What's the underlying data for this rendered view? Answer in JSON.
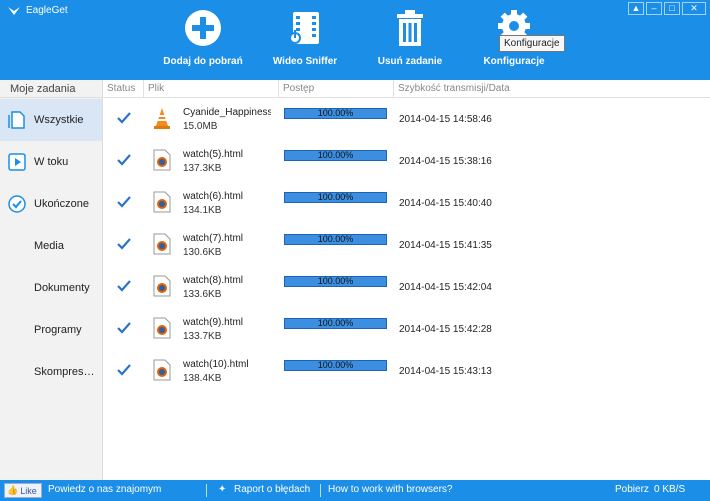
{
  "window": {
    "title": "EagleGet",
    "controls": [
      "shirt-icon",
      "minimize-icon",
      "maximize-icon",
      "close-icon"
    ]
  },
  "toolbar": {
    "add": {
      "label": "Dodaj do pobrań",
      "icon": "plus-icon"
    },
    "video": {
      "label": "Wideo Sniffer",
      "icon": "film-icon"
    },
    "delete": {
      "label": "Usuń zadanie",
      "icon": "trash-icon"
    },
    "settings": {
      "label": "Konfiguracje",
      "icon": "gear-icon"
    },
    "tooltip": "Konfiguracje"
  },
  "sidebar": {
    "title": "Moje zadania",
    "items": [
      {
        "label": "Wszystkie",
        "icon": "document-icon",
        "active": true
      },
      {
        "label": "W toku",
        "icon": "play-icon"
      },
      {
        "label": "Ukończone",
        "icon": "checkmark-circle-icon"
      },
      {
        "label": "Media"
      },
      {
        "label": "Dokumenty"
      },
      {
        "label": "Programy"
      },
      {
        "label": "Skompresowane"
      }
    ]
  },
  "table": {
    "columns": [
      "Status",
      "Plik",
      "Postęp",
      "Szybkość transmisji/Data"
    ],
    "rows": [
      {
        "name": "Cyanide_Happiness",
        "size": "15.0MB",
        "progress": "100.00%",
        "progress_value": 100,
        "date": "2014-04-15 14:58:46",
        "icon": "vlc-cone-icon"
      },
      {
        "name": "watch(5).html",
        "size": "137.3KB",
        "progress": "100.00%",
        "progress_value": 100,
        "date": "2014-04-15 15:38:16",
        "icon": "firefox-html-icon"
      },
      {
        "name": "watch(6).html",
        "size": "134.1KB",
        "progress": "100.00%",
        "progress_value": 100,
        "date": "2014-04-15 15:40:40",
        "icon": "firefox-html-icon"
      },
      {
        "name": "watch(7).html",
        "size": "130.6KB",
        "progress": "100.00%",
        "progress_value": 100,
        "date": "2014-04-15 15:41:35",
        "icon": "firefox-html-icon"
      },
      {
        "name": "watch(8).html",
        "size": "133.6KB",
        "progress": "100.00%",
        "progress_value": 100,
        "date": "2014-04-15 15:42:04",
        "icon": "firefox-html-icon"
      },
      {
        "name": "watch(9).html",
        "size": "133.7KB",
        "progress": "100.00%",
        "progress_value": 100,
        "date": "2014-04-15 15:42:28",
        "icon": "firefox-html-icon"
      },
      {
        "name": "watch(10).html",
        "size": "138.4KB",
        "progress": "100.00%",
        "progress_value": 100,
        "date": "2014-04-15 15:43:13",
        "icon": "firefox-html-icon"
      }
    ]
  },
  "statusbar": {
    "like": "Like",
    "tell_friends": "Powiedz o nas znajomym",
    "bug_report": "Raport o błędach",
    "browsers": "How to work with browsers?",
    "download_label": "Pobierz",
    "speed": "0 KB/S"
  },
  "colors": {
    "header": "#1b8ee8",
    "progress": "#2e7fd6",
    "check": "#2a73c9"
  }
}
